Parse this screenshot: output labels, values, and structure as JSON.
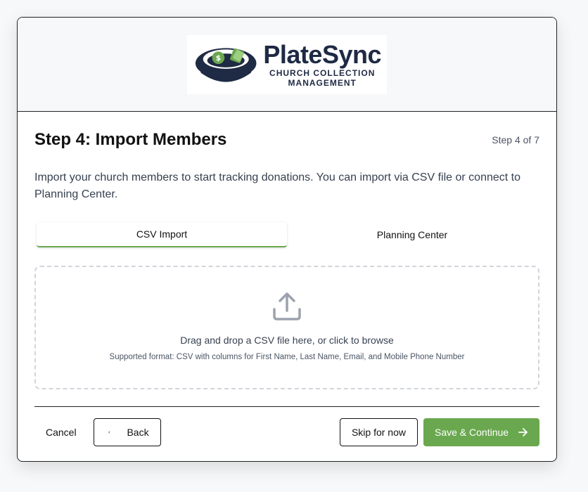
{
  "logo": {
    "name": "PlateSync",
    "tagline_line1": "CHURCH COLLECTION",
    "tagline_line2": "MANAGEMENT",
    "icon": "collection-plate-icon",
    "colors": {
      "navy": "#1f2a44",
      "green": "#6aa84f"
    }
  },
  "step": {
    "title": "Step 4: Import Members",
    "counter": "Step 4 of 7",
    "description": "Import your church members to start tracking donations. You can import via CSV file or connect to Planning Center."
  },
  "tabs": [
    {
      "label": "CSV Import",
      "active": true
    },
    {
      "label": "Planning Center",
      "active": false
    }
  ],
  "dropzone": {
    "icon": "upload-icon",
    "main_text": "Drag and drop a CSV file here, or click to browse",
    "sub_text": "Supported format: CSV with columns for First Name, Last Name, Email, and Mobile Phone Number"
  },
  "footer": {
    "cancel_label": "Cancel",
    "back_label": "Back",
    "skip_label": "Skip for now",
    "save_label": "Save & Continue"
  },
  "colors": {
    "accent": "#6aa84f",
    "border": "#222222",
    "dashed": "#d1d5db"
  }
}
